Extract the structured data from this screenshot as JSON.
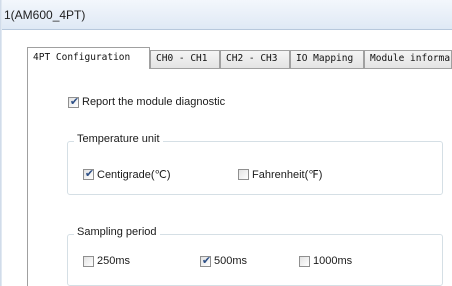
{
  "window": {
    "title": "1(AM600_4PT)"
  },
  "tabs": [
    {
      "label": "4PT Configuration",
      "active": true
    },
    {
      "label": "CH0 - CH1",
      "active": false
    },
    {
      "label": "CH2 - CH3",
      "active": false
    },
    {
      "label": "IO Mapping",
      "active": false
    },
    {
      "label": "Module informa",
      "active": false
    }
  ],
  "config": {
    "report_diagnostic": {
      "label": "Report the module diagnostic",
      "checked": true
    },
    "temperature_unit": {
      "title": "Temperature unit",
      "options": [
        {
          "label": "Centigrade(℃)",
          "checked": true
        },
        {
          "label": "Fahrenheit(℉)",
          "checked": false
        }
      ]
    },
    "sampling_period": {
      "title": "Sampling period",
      "options": [
        {
          "label": "250ms",
          "checked": false
        },
        {
          "label": "500ms",
          "checked": true
        },
        {
          "label": "1000ms",
          "checked": false
        }
      ]
    }
  },
  "colors": {
    "tick": "#2d4f86",
    "title_bar_top": "#f3f7fc",
    "title_bar_bottom": "#dfe9f5",
    "group_border": "#d5dfe5"
  },
  "icons": {
    "check": "check-icon"
  }
}
